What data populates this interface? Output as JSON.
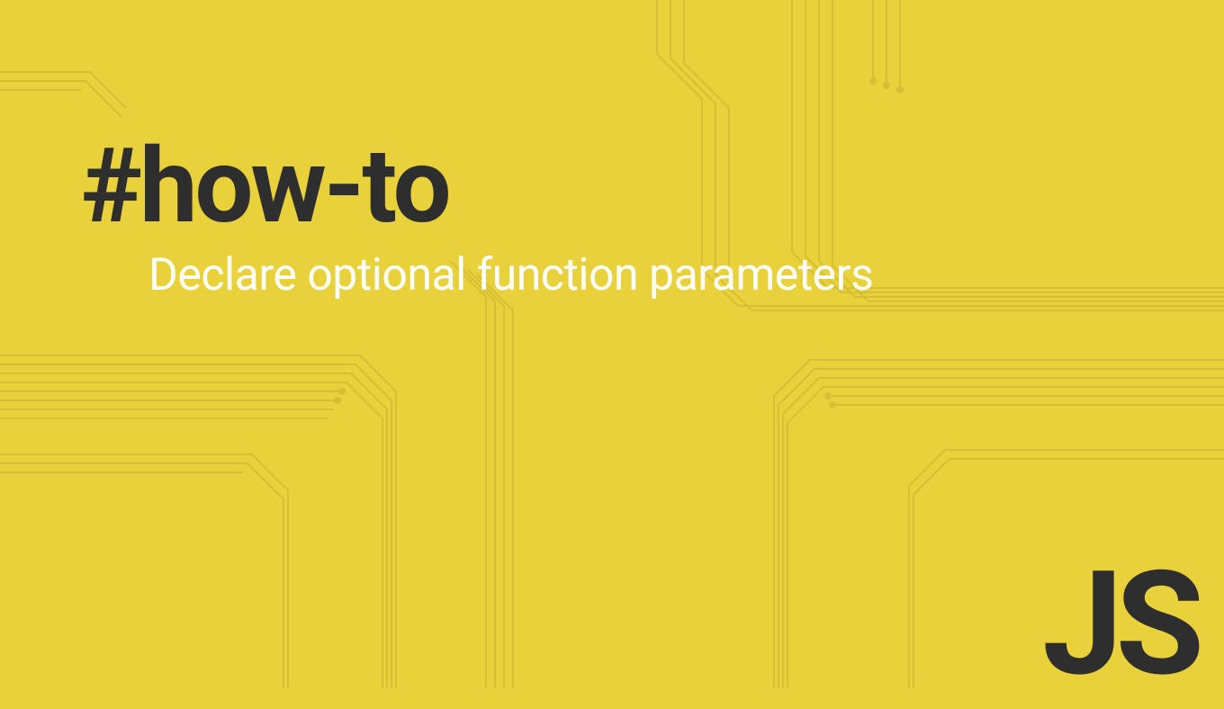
{
  "tag": "#how-to",
  "title": "Declare optional function parameters",
  "logo": "JS",
  "colors": {
    "background": "#e8d13b",
    "dark": "#2e2e2e",
    "light": "#ffffff",
    "trace": "#d4bf35"
  }
}
